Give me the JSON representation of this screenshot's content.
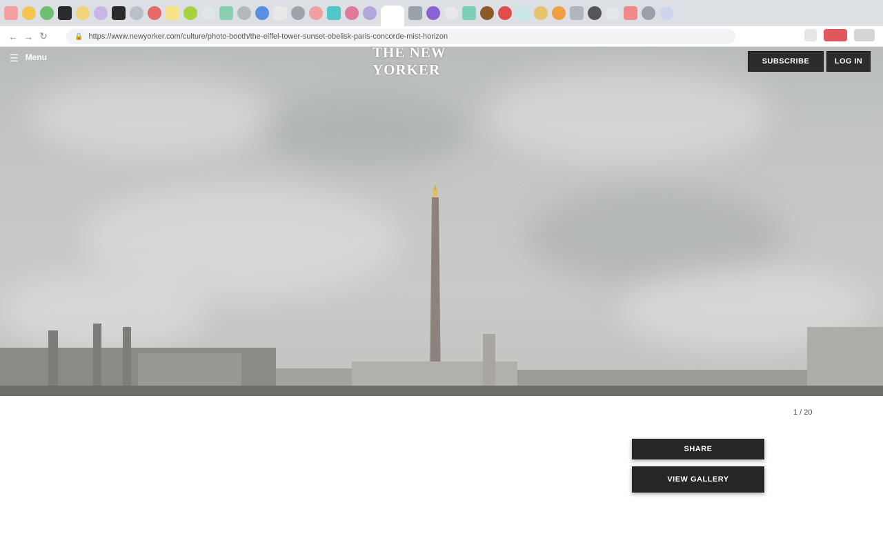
{
  "browser": {
    "tab_favicon_colors": [
      "#f2a0a0",
      "#f5c451",
      "#6cc070",
      "#2b2b2b",
      "#f3d27a",
      "#c9b6e4",
      "#2b2b2b",
      "#b9c0c8",
      "#e66a6a",
      "#f7e28a",
      "#a6d23f",
      "#dfe6ea",
      "#8ad0b0",
      "#b3b8be",
      "#5b8de0",
      "#e8e8e8",
      "#9ca3ab",
      "#f0a0a0",
      "#52c7c7",
      "#e07a9a",
      "#b3a6d9",
      "#9aa1a8",
      "#8a63d2",
      "#e8e8e8",
      "#7dd0b8",
      "#8a5a2a",
      "#e04d4d",
      "#c9e6e6",
      "#e3c46a",
      "#f0a040",
      "#b0b6bd",
      "#555555",
      "#e4e8ec",
      "#f08a8a",
      "#9aa1a8",
      "#cfd5f0"
    ],
    "address": "https://www.newyorker.com/culture/photo-booth/the-eiffel-tower-sunset-obelisk-paris-concorde-mist-horizon"
  },
  "header": {
    "menu_label": "Menu",
    "logo": "THE NEW YORKER",
    "subscribe_label": "SUBSCRIBE",
    "login_label": "LOG IN"
  },
  "hero": {
    "caption": "",
    "count": "1 / 20"
  },
  "article": {
    "paragraphs": [
      {
        "lead": "",
        "text": ""
      },
      {
        "lead": "",
        "text": ""
      },
      {
        "lead": "",
        "text": ""
      }
    ]
  },
  "sidebar": {
    "button_one": "SHARE",
    "button_two": "VIEW GALLERY"
  }
}
